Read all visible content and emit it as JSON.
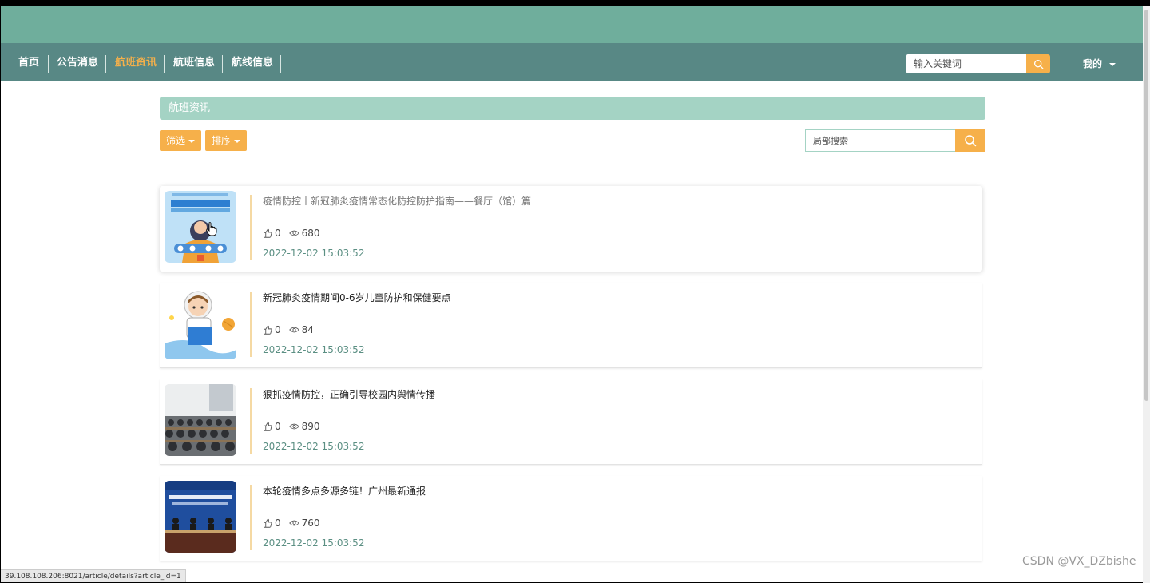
{
  "nav": {
    "items": [
      {
        "label": "首页"
      },
      {
        "label": "公告消息"
      },
      {
        "label": "航班资讯"
      },
      {
        "label": "航班信息"
      },
      {
        "label": "航线信息"
      }
    ],
    "search_placeholder": "输入关键词",
    "user_label": "我的"
  },
  "section": {
    "title": "航班资讯",
    "filter_label": "筛选",
    "sort_label": "排序",
    "search_placeholder": "局部搜索"
  },
  "articles": [
    {
      "title": "疫情防控丨新冠肺炎疫情常态化防控防护指南——餐厅（馆）篇",
      "likes": "0",
      "views": "680",
      "date": "2022-12-02 15:03:52"
    },
    {
      "title": "新冠肺炎疫情期间0-6岁儿童防护和保健要点",
      "likes": "0",
      "views": "84",
      "date": "2022-12-02 15:03:52"
    },
    {
      "title": "狠抓疫情防控，正确引导校园内舆情传播",
      "likes": "0",
      "views": "890",
      "date": "2022-12-02 15:03:52"
    },
    {
      "title": "本轮疫情多点多源多链！广州最新通报",
      "likes": "0",
      "views": "760",
      "date": "2022-12-02 15:03:52"
    }
  ],
  "status_url": "39.108.108.206:8021/article/details?article_id=1",
  "watermark": "CSDN @VX_DZbishe",
  "colors": {
    "topbar": "#6fae9c",
    "navbar": "#588885",
    "accent": "#f6b04a",
    "section_title_bg": "#a4d3c4",
    "date_text": "#5b8f83"
  }
}
